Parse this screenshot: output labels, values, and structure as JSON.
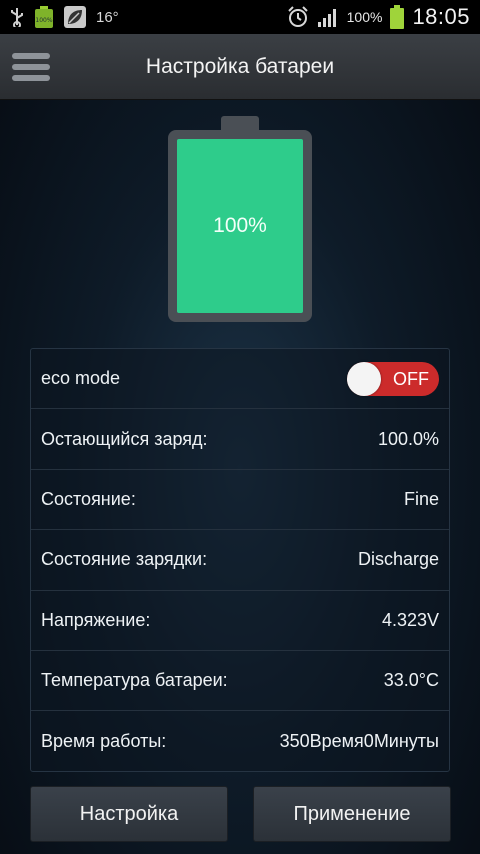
{
  "statusbar": {
    "temperature": "16°",
    "battery_percent": "100%",
    "time": "18:05",
    "icons": {
      "usb": "usb-icon",
      "battery_small": "battery-notification-icon",
      "leaf": "leaf-icon",
      "alarm": "alarm-icon",
      "signal": "signal-icon",
      "battery": "battery-icon"
    }
  },
  "header": {
    "title": "Настройка батареи",
    "menu_icon": "hamburger-menu-icon"
  },
  "battery": {
    "level_text": "100%",
    "level_fraction": 1.0,
    "fill_color": "#2ecc8b"
  },
  "info": {
    "eco_mode": {
      "label": "eco mode",
      "toggle_text": "OFF",
      "on": false
    },
    "rows": [
      {
        "label": "Остающийся заряд:",
        "value": "100.0%"
      },
      {
        "label": "Состояние:",
        "value": "Fine"
      },
      {
        "label": "Состояние зарядки:",
        "value": "Discharge"
      },
      {
        "label": "Напряжение:",
        "value": "4.323V"
      },
      {
        "label": "Температура батареи:",
        "value": "33.0°C"
      },
      {
        "label": "Время работы:",
        "value": "350Время0Минуты"
      }
    ]
  },
  "buttons": {
    "settings": "Настройка",
    "apply": "Применение"
  },
  "colors": {
    "accent_green": "#2ecc8b",
    "toggle_off_red": "#cc2b2b"
  }
}
